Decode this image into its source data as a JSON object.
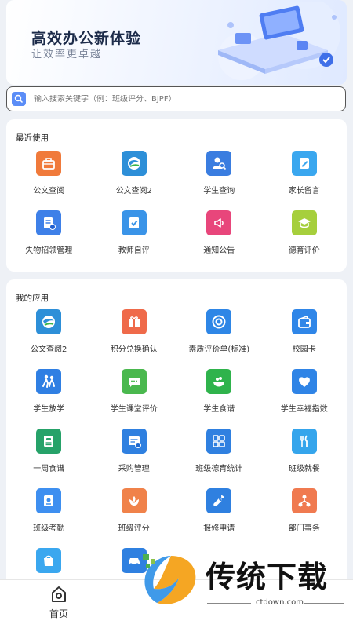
{
  "banner": {
    "title": "高效办公新体验",
    "subtitle": "让效率更卓越"
  },
  "search": {
    "placeholder": "输入搜索关键字（例：班级评分、BJPF）"
  },
  "recent": {
    "title": "最近使用",
    "apps": [
      {
        "label": "公文查阅",
        "icon": "briefcase-icon",
        "color": "#f07a3b"
      },
      {
        "label": "公文查阅2",
        "icon": "globe-icon",
        "color": "#2d8fd8"
      },
      {
        "label": "学生查询",
        "icon": "student-search-icon",
        "color": "#3a7de0"
      },
      {
        "label": "家长留言",
        "icon": "edit-note-icon",
        "color": "#3aa7ef"
      },
      {
        "label": "失物招领管理",
        "icon": "document-edit-icon",
        "color": "#3e80e8"
      },
      {
        "label": "教师自评",
        "icon": "checklist-icon",
        "color": "#3a94e8"
      },
      {
        "label": "通知公告",
        "icon": "speaker-icon",
        "color": "#e8467b"
      },
      {
        "label": "德育评价",
        "icon": "graduation-cap-icon",
        "color": "#a6cf3c"
      }
    ]
  },
  "my_apps": {
    "title": "我的应用",
    "apps": [
      {
        "label": "公文查阅2",
        "icon": "globe-icon",
        "color": "#2d8fd8"
      },
      {
        "label": "积分兑换确认",
        "icon": "gift-icon",
        "color": "#ef6a4a"
      },
      {
        "label": "素质评价单(标准)",
        "icon": "circle-arrow-icon",
        "color": "#2e86e6"
      },
      {
        "label": "校园卡",
        "icon": "wallet-icon",
        "color": "#2f86e8"
      },
      {
        "label": "学生放学",
        "icon": "running-kids-icon",
        "color": "#2f7fe3"
      },
      {
        "label": "学生课堂评价",
        "icon": "chat-bubble-icon",
        "color": "#4ab84e"
      },
      {
        "label": "学生食谱",
        "icon": "food-bowl-icon",
        "color": "#2fb34c"
      },
      {
        "label": "学生幸福指数",
        "icon": "heart-icon",
        "color": "#2f84e6"
      },
      {
        "label": "一周食谱",
        "icon": "recipe-book-icon",
        "color": "#26a269"
      },
      {
        "label": "采购管理",
        "icon": "purchase-icon",
        "color": "#2f80e0"
      },
      {
        "label": "班级德育统计",
        "icon": "grid-apps-icon",
        "color": "#2f80e0"
      },
      {
        "label": "班级就餐",
        "icon": "cutlery-icon",
        "color": "#35a5ec"
      },
      {
        "label": "班级考勤",
        "icon": "attendance-icon",
        "color": "#3e8ff0"
      },
      {
        "label": "班级评分",
        "icon": "flower-icon",
        "color": "#f0824a"
      },
      {
        "label": "报修申请",
        "icon": "wrench-icon",
        "color": "#2f80e0"
      },
      {
        "label": "部门事务",
        "icon": "org-chart-icon",
        "color": "#f07a50"
      },
      {
        "label": "",
        "icon": "shopping-bag-icon",
        "color": "#3aa7ef"
      },
      {
        "label": "",
        "icon": "car-icon",
        "color": "#2f80e0"
      }
    ]
  },
  "bottom_nav": {
    "home_label": "首页"
  },
  "watermark": {
    "text": "传统下载",
    "domain": "ctdown.com"
  }
}
